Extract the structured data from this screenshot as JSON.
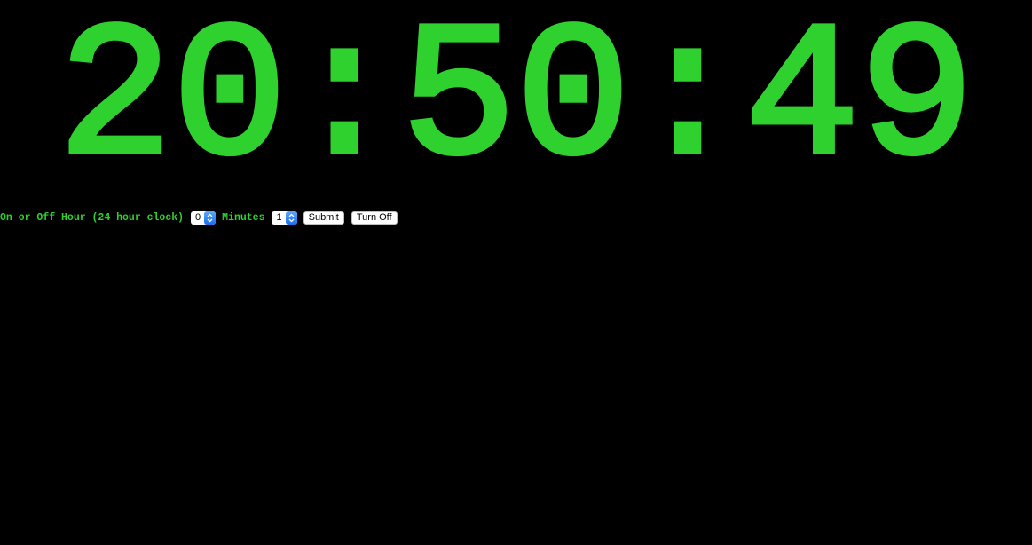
{
  "clock": {
    "time": "20:50:49"
  },
  "colors": {
    "accent": "#2fd12f",
    "background": "#000000"
  },
  "controls": {
    "hour_label": "On or Off Hour (24 hour clock)",
    "hour_value": "0",
    "minutes_label": "Minutes",
    "minutes_value": "1",
    "submit_label": "Submit",
    "turn_off_label": "Turn Off"
  },
  "icons": {
    "stepper": "up-down-chevron-icon"
  }
}
